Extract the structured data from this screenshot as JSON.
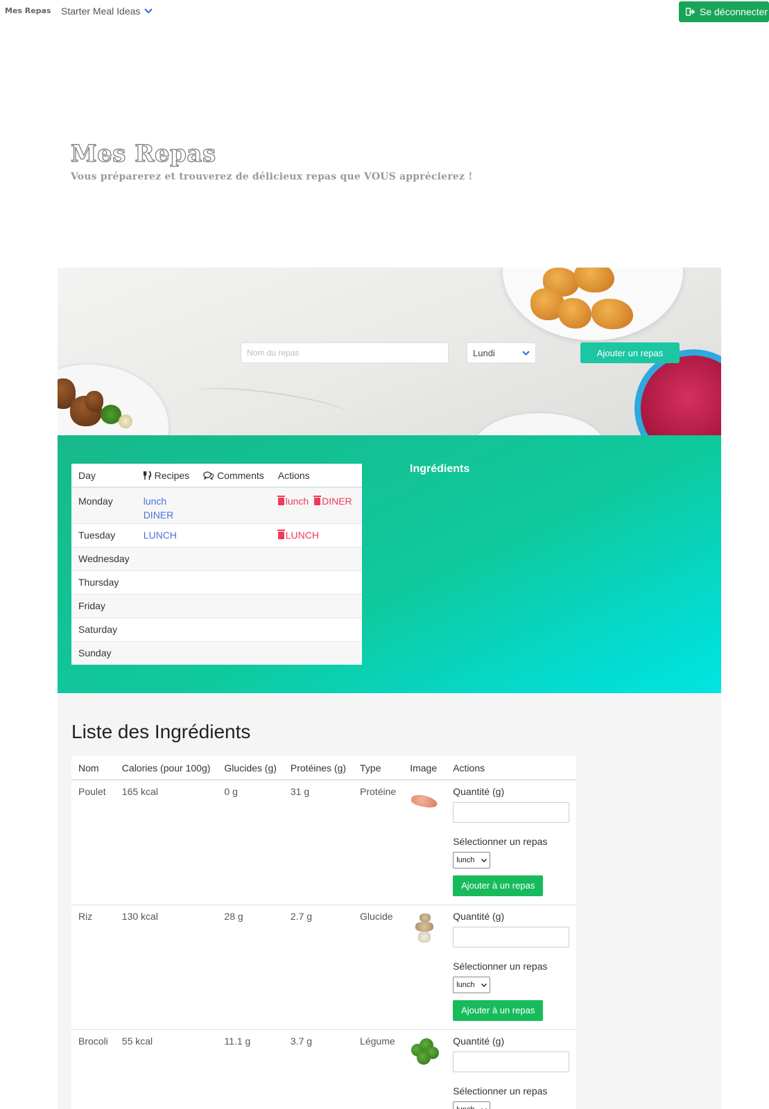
{
  "navbar": {
    "brand": "Mes Repas",
    "dropdown_label": "Starter Meal Ideas",
    "logout_label": "Se déconnecter"
  },
  "hero": {
    "title": "Mes Repas",
    "subtitle": "Vous préparerez et trouverez de délicieux repas que VOUS apprécierez !"
  },
  "meal_form": {
    "name_placeholder": "Nom du repas",
    "day_selected": "Lundi",
    "submit_label": "Ajouter un repas"
  },
  "week_table": {
    "headers": {
      "day": "Day",
      "recipes": "Recipes",
      "comments": "Comments",
      "actions": "Actions"
    },
    "rows": [
      {
        "day": "Monday",
        "recipes": [
          "lunch",
          "DINER"
        ],
        "actions": [
          "lunch",
          "DINER"
        ]
      },
      {
        "day": "Tuesday",
        "recipes": [
          "LUNCH"
        ],
        "actions": [
          "LUNCH"
        ]
      },
      {
        "day": "Wednesday"
      },
      {
        "day": "Thursday"
      },
      {
        "day": "Friday"
      },
      {
        "day": "Saturday"
      },
      {
        "day": "Sunday"
      }
    ]
  },
  "ingredients_panel": {
    "title": "Ingrédients"
  },
  "ingredient_list": {
    "title": "Liste des Ingrédients",
    "headers": {
      "name": "Nom",
      "calories": "Calories (pour 100g)",
      "carbs": "Glucides (g)",
      "protein": "Protéines (g)",
      "type": "Type",
      "image": "Image",
      "actions": "Actions"
    },
    "quantity_label": "Quantité (g)",
    "select_meal_label": "Sélectionner un repas",
    "select_meal_value": "lunch",
    "add_button_label": "Ajouter à un repas",
    "rows": [
      {
        "name": "Poulet",
        "calories": "165 kcal",
        "carbs": "0 g",
        "protein": "31 g",
        "type": "Protéine",
        "image_icon": "chicken-image"
      },
      {
        "name": "Riz",
        "calories": "130 kcal",
        "carbs": "28 g",
        "protein": "2.7 g",
        "type": "Glucide",
        "image_icon": "rice-image"
      },
      {
        "name": "Brocoli",
        "calories": "55 kcal",
        "carbs": "11.1 g",
        "protein": "3.7 g",
        "type": "Légume",
        "image_icon": "broccoli-image"
      }
    ]
  },
  "colors": {
    "logout_green": "#18a558",
    "teal_button": "#1cc6a3",
    "gradient_start": "#17b98a",
    "gradient_end": "#00e5e0",
    "link_blue": "#4a72d8",
    "delete_red": "#ef3a5d",
    "add_button_green": "#18bb5b"
  }
}
